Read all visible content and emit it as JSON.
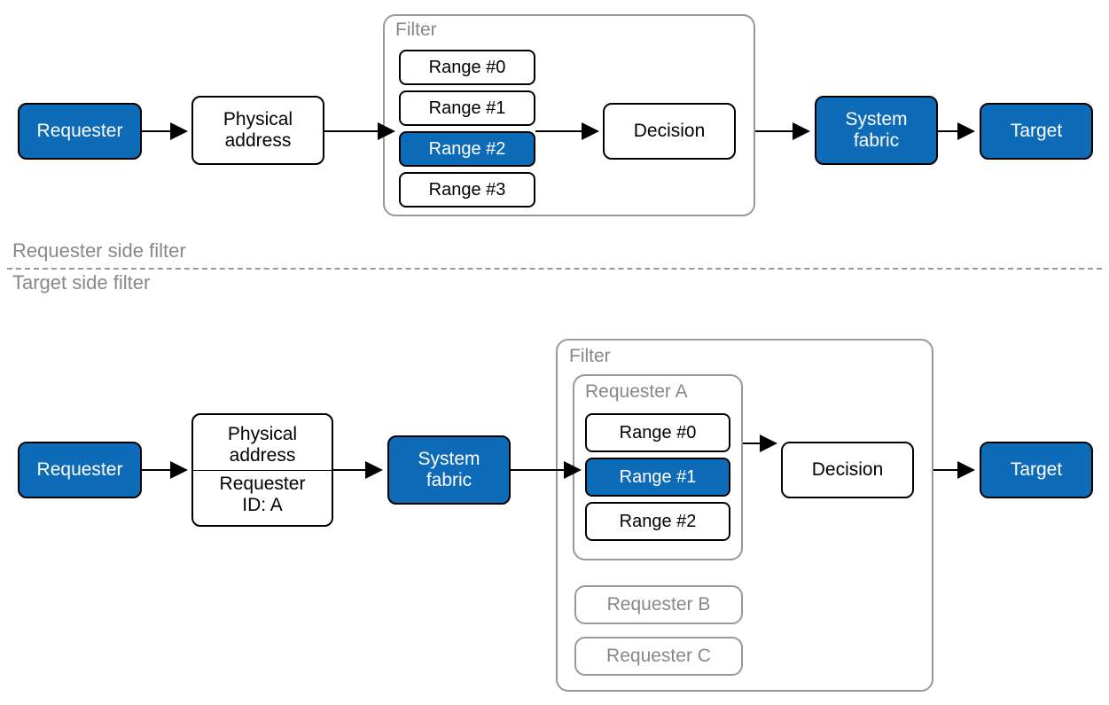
{
  "top": {
    "requester": "Requester",
    "physical_address": "Physical\naddress",
    "filter_label": "Filter",
    "ranges": [
      "Range #0",
      "Range #1",
      "Range #2",
      "Range #3"
    ],
    "decision": "Decision",
    "system_fabric": "System\nfabric",
    "target": "Target"
  },
  "divider": {
    "upper": "Requester side filter",
    "lower": "Target side filter"
  },
  "bottom": {
    "requester": "Requester",
    "pa_top": "Physical\naddress",
    "pa_bot": "Requester\nID: A",
    "system_fabric": "System\nfabric",
    "filter_label": "Filter",
    "reqA_label": "Requester A",
    "ranges": [
      "Range #0",
      "Range #1",
      "Range #2"
    ],
    "decision": "Decision",
    "reqB": "Requester B",
    "reqC": "Requester C",
    "target": "Target"
  }
}
